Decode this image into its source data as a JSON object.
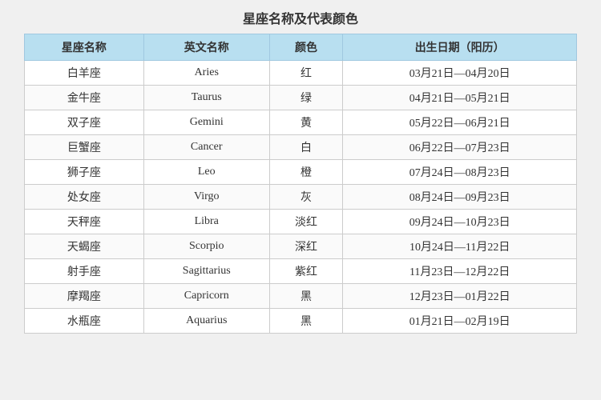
{
  "title": "星座名称及代表颜色",
  "headers": [
    "星座名称",
    "英文名称",
    "颜色",
    "出生日期（阳历）"
  ],
  "rows": [
    {
      "chinese": "白羊座",
      "english": "Aries",
      "color": "红",
      "date": "03月21日—04月20日"
    },
    {
      "chinese": "金牛座",
      "english": "Taurus",
      "color": "绿",
      "date": "04月21日—05月21日"
    },
    {
      "chinese": "双子座",
      "english": "Gemini",
      "color": "黄",
      "date": "05月22日—06月21日"
    },
    {
      "chinese": "巨蟹座",
      "english": "Cancer",
      "color": "白",
      "date": "06月22日—07月23日"
    },
    {
      "chinese": "狮子座",
      "english": "Leo",
      "color": "橙",
      "date": "07月24日—08月23日"
    },
    {
      "chinese": "处女座",
      "english": "Virgo",
      "color": "灰",
      "date": "08月24日—09月23日"
    },
    {
      "chinese": "天秤座",
      "english": "Libra",
      "color": "淡红",
      "date": "09月24日—10月23日"
    },
    {
      "chinese": "天蝎座",
      "english": "Scorpio",
      "color": "深红",
      "date": "10月24日—11月22日"
    },
    {
      "chinese": "射手座",
      "english": "Sagittarius",
      "color": "紫红",
      "date": "11月23日—12月22日"
    },
    {
      "chinese": "摩羯座",
      "english": "Capricorn",
      "color": "黑",
      "date": "12月23日—01月22日"
    },
    {
      "chinese": "水瓶座",
      "english": "Aquarius",
      "color": "黑",
      "date": "01月21日—02月19日"
    }
  ]
}
